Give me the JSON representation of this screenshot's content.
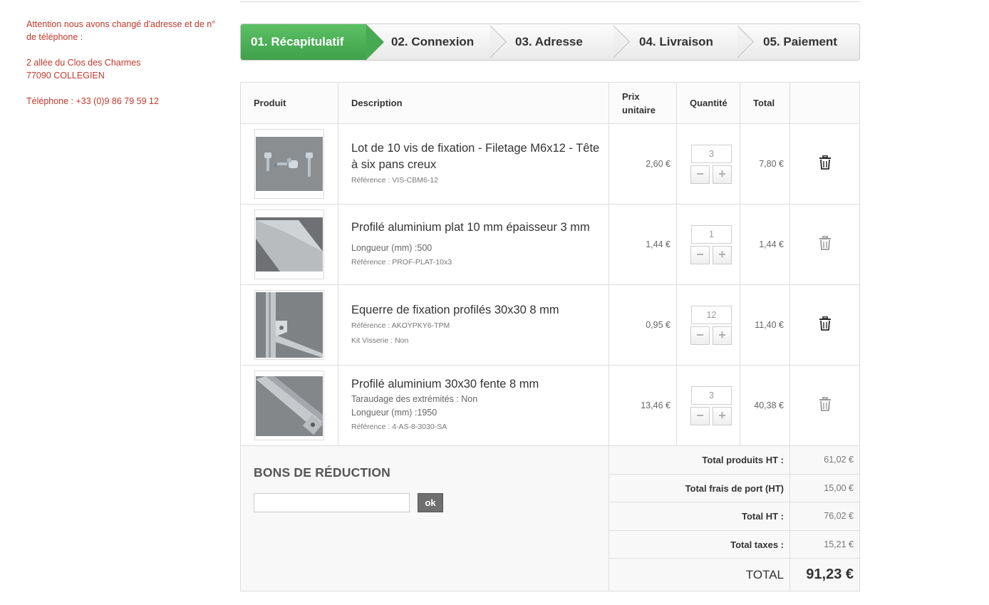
{
  "notice": {
    "message": "Attention nous avons changé d'adresse et de n° de téléphone :",
    "address_line1": "2 allée du Clos des Charmes",
    "address_line2": "77090 COLLEGIEN",
    "phone": "Téléphone : +33 (0)9 86 79 59 12"
  },
  "steps": [
    {
      "label": "01. Récapitulatif",
      "active": true
    },
    {
      "label": "02. Connexion",
      "active": false
    },
    {
      "label": "03. Adresse",
      "active": false
    },
    {
      "label": "04. Livraison",
      "active": false
    },
    {
      "label": "05. Paiement",
      "active": false
    }
  ],
  "table": {
    "headers": {
      "product": "Produit",
      "description": "Description",
      "unit_price_line1": "Prix",
      "unit_price_line2": "unitaire",
      "quantity": "Quantité",
      "total": "Total"
    },
    "rows": [
      {
        "name": "Lot de 10 vis de fixation - Filetage M6x12 - Tête à six pans creux",
        "ref": "Référence : VIS-CBM6-12",
        "unit_price": "2,60 €",
        "quantity": "3",
        "total": "7,80 €",
        "image": "screws-image"
      },
      {
        "name": "Profilé aluminium plat 10 mm épaisseur 3 mm",
        "attr1": "Longueur (mm) :500",
        "ref": "Référence : PROF-PLAT-10x3",
        "unit_price": "1,44 €",
        "quantity": "1",
        "total": "1,44 €",
        "image": "flat-profile-image"
      },
      {
        "name": "Equerre de fixation profilés 30x30 8 mm",
        "ref": "Référence : AKOYPKY6-TPM",
        "ref2": "Kit Visserie : Non",
        "unit_price": "0,95 €",
        "quantity": "12",
        "total": "11,40 €",
        "image": "bracket-image"
      },
      {
        "name": "Profilé aluminium 30x30 fente 8 mm",
        "attr1": "Taraudage des extrémités : Non",
        "attr2": "Longueur (mm) :1950",
        "ref": "Référence : 4-AS-8-3030-SA",
        "unit_price": "13,46 €",
        "quantity": "3",
        "total": "40,38 €",
        "image": "slot-profile-image"
      }
    ],
    "qty_minus": "−",
    "qty_plus": "+"
  },
  "voucher": {
    "title": "BONS DE RÉDUCTION",
    "input_value": "",
    "button": "ok"
  },
  "totals": [
    {
      "label": "Total produits HT :",
      "value": "61,02 €"
    },
    {
      "label": "Total frais de port (HT)",
      "value": "15,00 €"
    },
    {
      "label": "Total HT :",
      "value": "76,02 €"
    },
    {
      "label": "Total taxes :",
      "value": "15,21 €"
    }
  ],
  "grand_total": {
    "label": "TOTAL",
    "value": "91,23 €"
  },
  "colors": {
    "notice": "#c0392b",
    "active_step": "#47a952",
    "trash_dark": "#2b2b2b",
    "trash_light": "#9a9a9a"
  }
}
